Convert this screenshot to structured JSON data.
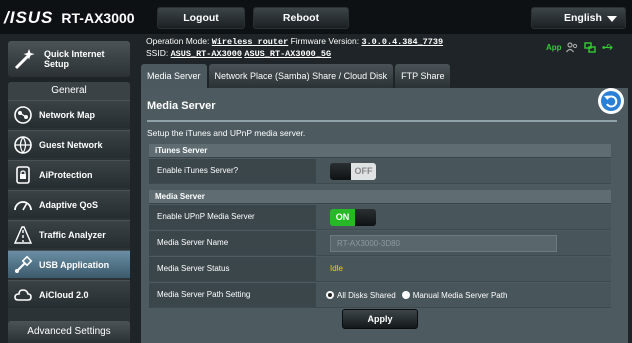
{
  "header": {
    "brand": "/ISUS",
    "model": "RT-AX3000",
    "logout_label": "Logout",
    "reboot_label": "Reboot",
    "language": "English"
  },
  "status": {
    "operation_mode_label": "Operation Mode:",
    "operation_mode": "Wireless router",
    "firmware_label": "Firmware Version:",
    "firmware": "3.0.0.4.384_7739",
    "ssid_label": "SSID:",
    "ssid_1": "ASUS_RT-AX3000",
    "ssid_2": "ASUS_RT-AX3000_5G",
    "app_label": "App",
    "colors": {
      "app": "#33cc33",
      "icon": "#33cc33"
    }
  },
  "sidebar": {
    "quick_setup": "Quick Internet Setup",
    "quick_setup_line1": "Quick Internet",
    "quick_setup_line2": "Setup",
    "group_title": "General",
    "items": [
      {
        "label": "Network Map",
        "icon": "network-map-icon"
      },
      {
        "label": "Guest Network",
        "icon": "guest-network-icon"
      },
      {
        "label": "AiProtection",
        "icon": "lock-icon"
      },
      {
        "label": "Adaptive QoS",
        "icon": "gauge-icon"
      },
      {
        "label": "Traffic Analyzer",
        "icon": "traffic-analyzer-icon"
      },
      {
        "label": "USB Application",
        "icon": "usb-icon",
        "active": true
      },
      {
        "label": "AiCloud 2.0",
        "icon": "cloud-icon"
      }
    ],
    "advanced": "Advanced Settings",
    "colors": {
      "active": "#5a7f95"
    }
  },
  "tabs": [
    {
      "label": "Media Server",
      "active": true
    },
    {
      "label": "Network Place (Samba) Share / Cloud Disk"
    },
    {
      "label": "FTP Share"
    }
  ],
  "panel": {
    "title": "Media Server",
    "description": "Setup the iTunes and UPnP media server.",
    "itunes": {
      "heading": "iTunes Server",
      "enable_label": "Enable iTunes Server?",
      "enable_state": "OFF"
    },
    "media": {
      "heading": "Media Server",
      "upnp_label": "Enable UPnP Media Server",
      "upnp_state": "ON",
      "name_label": "Media Server Name",
      "name_value": "RT-AX3000-3D80",
      "status_label": "Media Server Status",
      "status_value": "Idle",
      "path_label": "Media Server Path Setting",
      "path_options": [
        "All Disks Shared",
        "Manual Media Server Path"
      ],
      "path_selected": "All Disks Shared"
    },
    "apply_label": "Apply",
    "colors": {
      "on": "#27b827",
      "idle": "#ffcc00"
    }
  }
}
